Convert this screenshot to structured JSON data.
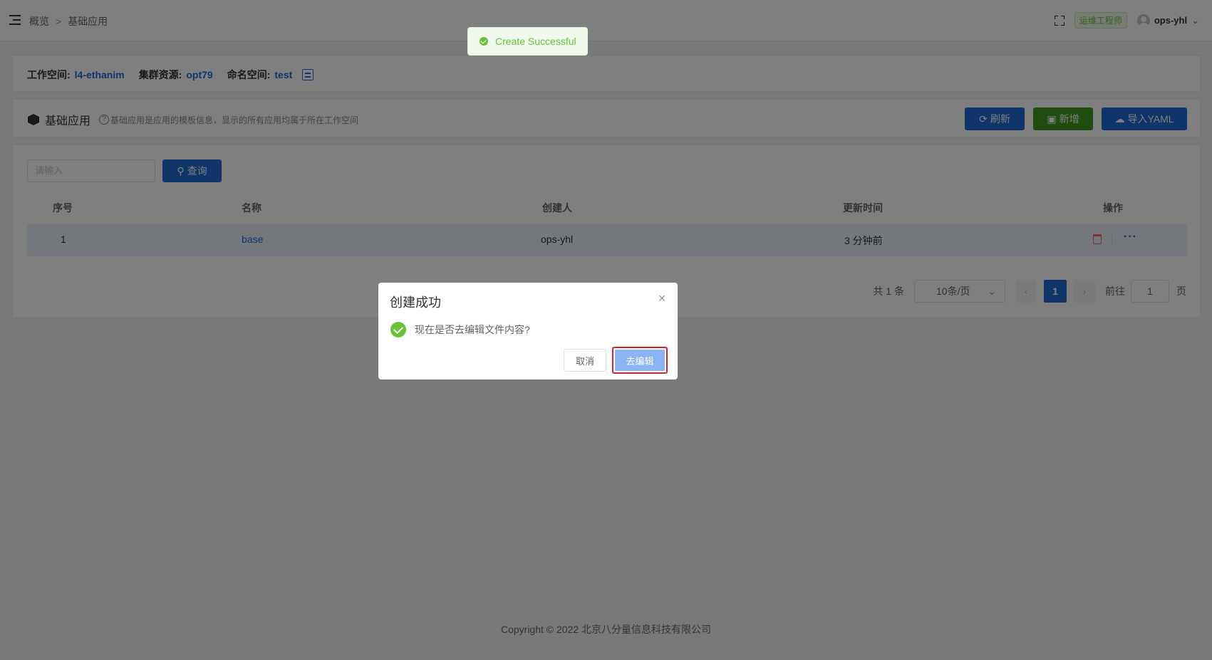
{
  "header": {
    "breadcrumb": [
      "概览",
      "基础应用"
    ],
    "breadcrumb_sep": ">",
    "role_tag": "运维工程师",
    "username": "ops-yhl",
    "user_chevron": "⌄"
  },
  "workspace": {
    "workspace_label": "工作空间:",
    "workspace_value": "l4-ethanim",
    "cluster_label": "集群资源:",
    "cluster_value": "opt79",
    "namespace_label": "命名空间:",
    "namespace_value": "test"
  },
  "title_bar": {
    "title": "基础应用",
    "hint_icon": "?",
    "hint": "基础应用是应用的模板信息，显示的所有应用均属于所在工作空间",
    "refresh_icon": "⟳",
    "refresh_label": "刷新",
    "add_icon": "▣",
    "add_label": "新增",
    "import_icon": "☁",
    "import_label": "导入YAML"
  },
  "search": {
    "placeholder": "请输入",
    "query_icon": "⚲",
    "query_label": "查询"
  },
  "table": {
    "columns": [
      "序号",
      "名称",
      "创建人",
      "更新时间",
      "操作"
    ],
    "rows": [
      {
        "index": "1",
        "name": "base",
        "creator": "ops-yhl",
        "updated": "3 分钟前"
      }
    ],
    "more_icon": "···"
  },
  "pagination": {
    "total": "共 1 条",
    "page_size": "10条/页",
    "prev_icon": "‹",
    "next_icon": "›",
    "current_page": "1",
    "goto_label": "前往",
    "goto_value": "1",
    "page_unit": "页"
  },
  "footer": {
    "copyright": "Copyright © 2022 北京八分量信息科技有限公司"
  },
  "toast": {
    "message": "Create Successful",
    "color": "#67c23a"
  },
  "dialog": {
    "title": "创建成功",
    "close_icon": "×",
    "message": "现在是否去编辑文件内容?",
    "cancel_label": "取消",
    "confirm_label": "去编辑"
  },
  "colors": {
    "primary": "#1e6bd4",
    "success": "#3e9a1e",
    "danger": "#f56c6c",
    "highlight_border": "#e02020"
  }
}
